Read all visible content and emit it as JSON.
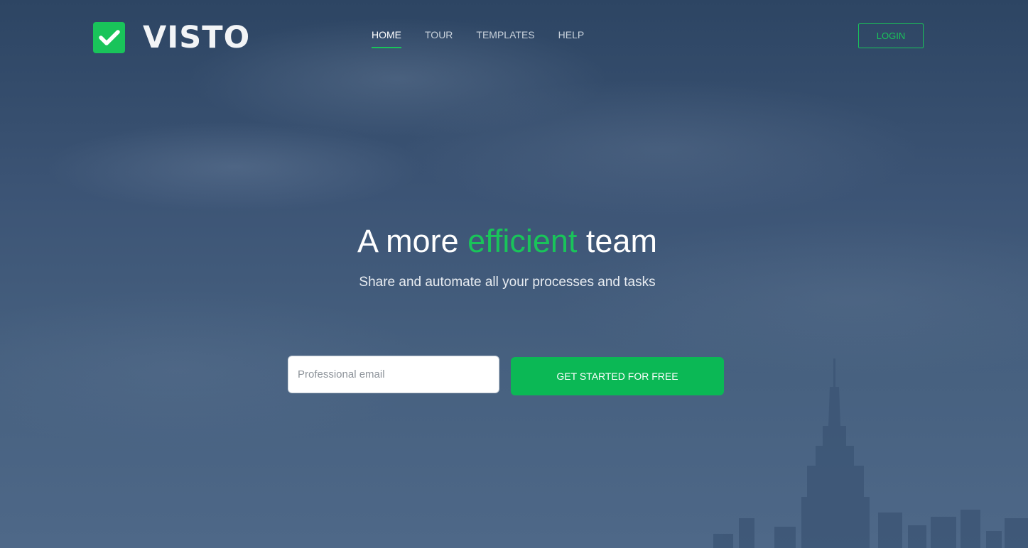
{
  "brand": {
    "name": "VISTO",
    "accent_color": "#19c45a",
    "logo_icon": "checkmark-icon"
  },
  "nav": {
    "items": [
      {
        "label": "HOME",
        "active": true
      },
      {
        "label": "TOUR",
        "active": false
      },
      {
        "label": "TEMPLATES",
        "active": false
      },
      {
        "label": "HELP",
        "active": false
      }
    ],
    "login_label": "LOGIN"
  },
  "hero": {
    "headline_before": "A more",
    "headline_accent": "efficient",
    "headline_after": "team",
    "subheadline": "Share and automate all your processes and tasks"
  },
  "signup": {
    "email_placeholder": "Professional email",
    "email_value": "",
    "cta_label": "GET STARTED FOR FREE"
  }
}
